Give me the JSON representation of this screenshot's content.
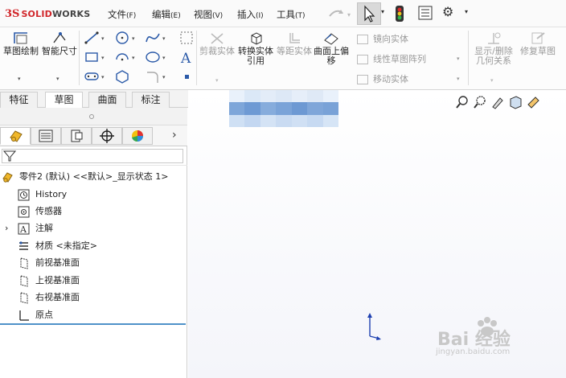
{
  "app": {
    "logo_ds": "3S",
    "logo_solid": "SOLID",
    "logo_works": "WORKS",
    "brand_color": "#d1262a"
  },
  "menu": [
    {
      "label": "文件",
      "key": "(F)"
    },
    {
      "label": "编辑",
      "key": "(E)"
    },
    {
      "label": "视图",
      "key": "(V)"
    },
    {
      "label": "插入",
      "key": "(I)"
    },
    {
      "label": "工具",
      "key": "(T)"
    }
  ],
  "quick_access": {
    "undo_icon": "undo-arrow-icon",
    "select_icon": "cursor-arrow-icon",
    "traffic_icon": "traffic-light-icon",
    "options_icon": "file-properties-icon",
    "gear_icon": "gear-icon",
    "dropdown_glyph": "▾"
  },
  "ribbon": {
    "sketch": "草图绘制",
    "smart_dim": "智能尺寸",
    "trim": "剪裁实体",
    "convert": "转换实体引用",
    "offset": "等距实体",
    "surface_offset": "曲面上偏移",
    "mirror": "镜向实体",
    "linear_pattern": "线性草图阵列",
    "move": "移动实体",
    "show_delete": "显示/删除几何关系",
    "repair": "修复草图",
    "dropdown_glyph": "▾"
  },
  "tabs": [
    "特征",
    "草图",
    "曲面",
    "标注"
  ],
  "active_tab": 1,
  "panel": {
    "more_glyph": "›",
    "filter_icon": "funnel-icon"
  },
  "tree": [
    {
      "label": "零件2 (默认) <<默认>_显示状态 1>",
      "icon": "part-icon",
      "level": 0
    },
    {
      "label": "History",
      "icon": "history-icon",
      "level": 1
    },
    {
      "label": "传感器",
      "icon": "sensor-icon",
      "level": 1
    },
    {
      "label": "注解",
      "icon": "annotation-icon",
      "level": 1,
      "expandable": true
    },
    {
      "label": "材质 <未指定>",
      "icon": "material-icon",
      "level": 1
    },
    {
      "label": "前视基准面",
      "icon": "plane-icon",
      "level": 1
    },
    {
      "label": "上视基准面",
      "icon": "plane-icon",
      "level": 1
    },
    {
      "label": "右视基准面",
      "icon": "plane-icon",
      "level": 1
    },
    {
      "label": "原点",
      "icon": "origin-icon",
      "level": 1
    }
  ],
  "expand_glyph": "›",
  "watermark": {
    "text": "Bai 经验",
    "url": "jingyan.baidu.com"
  }
}
